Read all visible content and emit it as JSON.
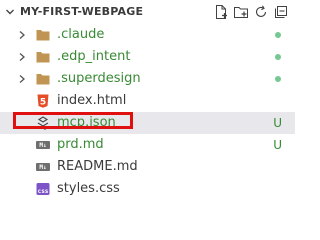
{
  "explorer": {
    "title": "MY-FIRST-WEBPAGE",
    "actions": [
      {
        "name": "new-file-icon"
      },
      {
        "name": "new-folder-icon"
      },
      {
        "name": "refresh-icon"
      },
      {
        "name": "collapse-all-icon"
      }
    ],
    "items": [
      {
        "label": ".claude",
        "type": "folder",
        "status": "dot"
      },
      {
        "label": ".edp_intent",
        "type": "folder",
        "status": "dot"
      },
      {
        "label": ".superdesign",
        "type": "folder",
        "status": "dot"
      },
      {
        "label": "index.html",
        "type": "html-file",
        "status": ""
      },
      {
        "label": "mcp.json",
        "type": "json-file",
        "status": "U"
      },
      {
        "label": "prd.md",
        "type": "markdown-file",
        "status": "U"
      },
      {
        "label": "README.md",
        "type": "markdown-file",
        "status": ""
      },
      {
        "label": "styles.css",
        "type": "css-file",
        "status": ""
      }
    ],
    "colors": {
      "added": "#388a34",
      "dot": "#73c991",
      "folder": "#c09553",
      "html": "#e44d26",
      "css": "#7d54c8",
      "highlight": "#e01010"
    },
    "icon_text": {
      "markdown": "M↓",
      "css": "css",
      "html": "5"
    }
  }
}
